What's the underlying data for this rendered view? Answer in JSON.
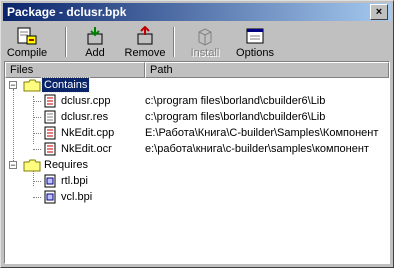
{
  "window": {
    "title": "Package - dclusr.bpk",
    "close_glyph": "×"
  },
  "toolbar": {
    "buttons": [
      {
        "label": "Compile",
        "icon": "compile-icon",
        "enabled": true
      },
      {
        "label": "Add",
        "icon": "add-icon",
        "enabled": true
      },
      {
        "label": "Remove",
        "icon": "remove-icon",
        "enabled": true
      },
      {
        "label": "Install",
        "icon": "install-icon",
        "enabled": false
      },
      {
        "label": "Options",
        "icon": "options-icon",
        "enabled": true
      }
    ]
  },
  "columns": {
    "files": "Files",
    "path": "Path"
  },
  "tree": {
    "contains": {
      "label": "Contains",
      "expander": "−",
      "items": [
        {
          "name": "dclusr.cpp",
          "path": "c:\\program files\\borland\\cbuilder6\\Lib"
        },
        {
          "name": "dclusr.res",
          "path": "c:\\program files\\borland\\cbuilder6\\Lib"
        },
        {
          "name": "NkEdit.cpp",
          "path": "E:\\Работа\\Книга\\C-builder\\Samples\\Компонент"
        },
        {
          "name": "NkEdit.ocr",
          "path": "e:\\работа\\книга\\c-builder\\samples\\компонент"
        }
      ]
    },
    "requires": {
      "label": "Requires",
      "expander": "−",
      "items": [
        {
          "name": "rtl.bpi"
        },
        {
          "name": "vcl.bpi"
        }
      ]
    }
  },
  "colors": {
    "title_start": "#0a246a",
    "title_end": "#a6caf0",
    "selection": "#0a246a",
    "folder": "#fffd80",
    "document_mark": "#c00000"
  }
}
